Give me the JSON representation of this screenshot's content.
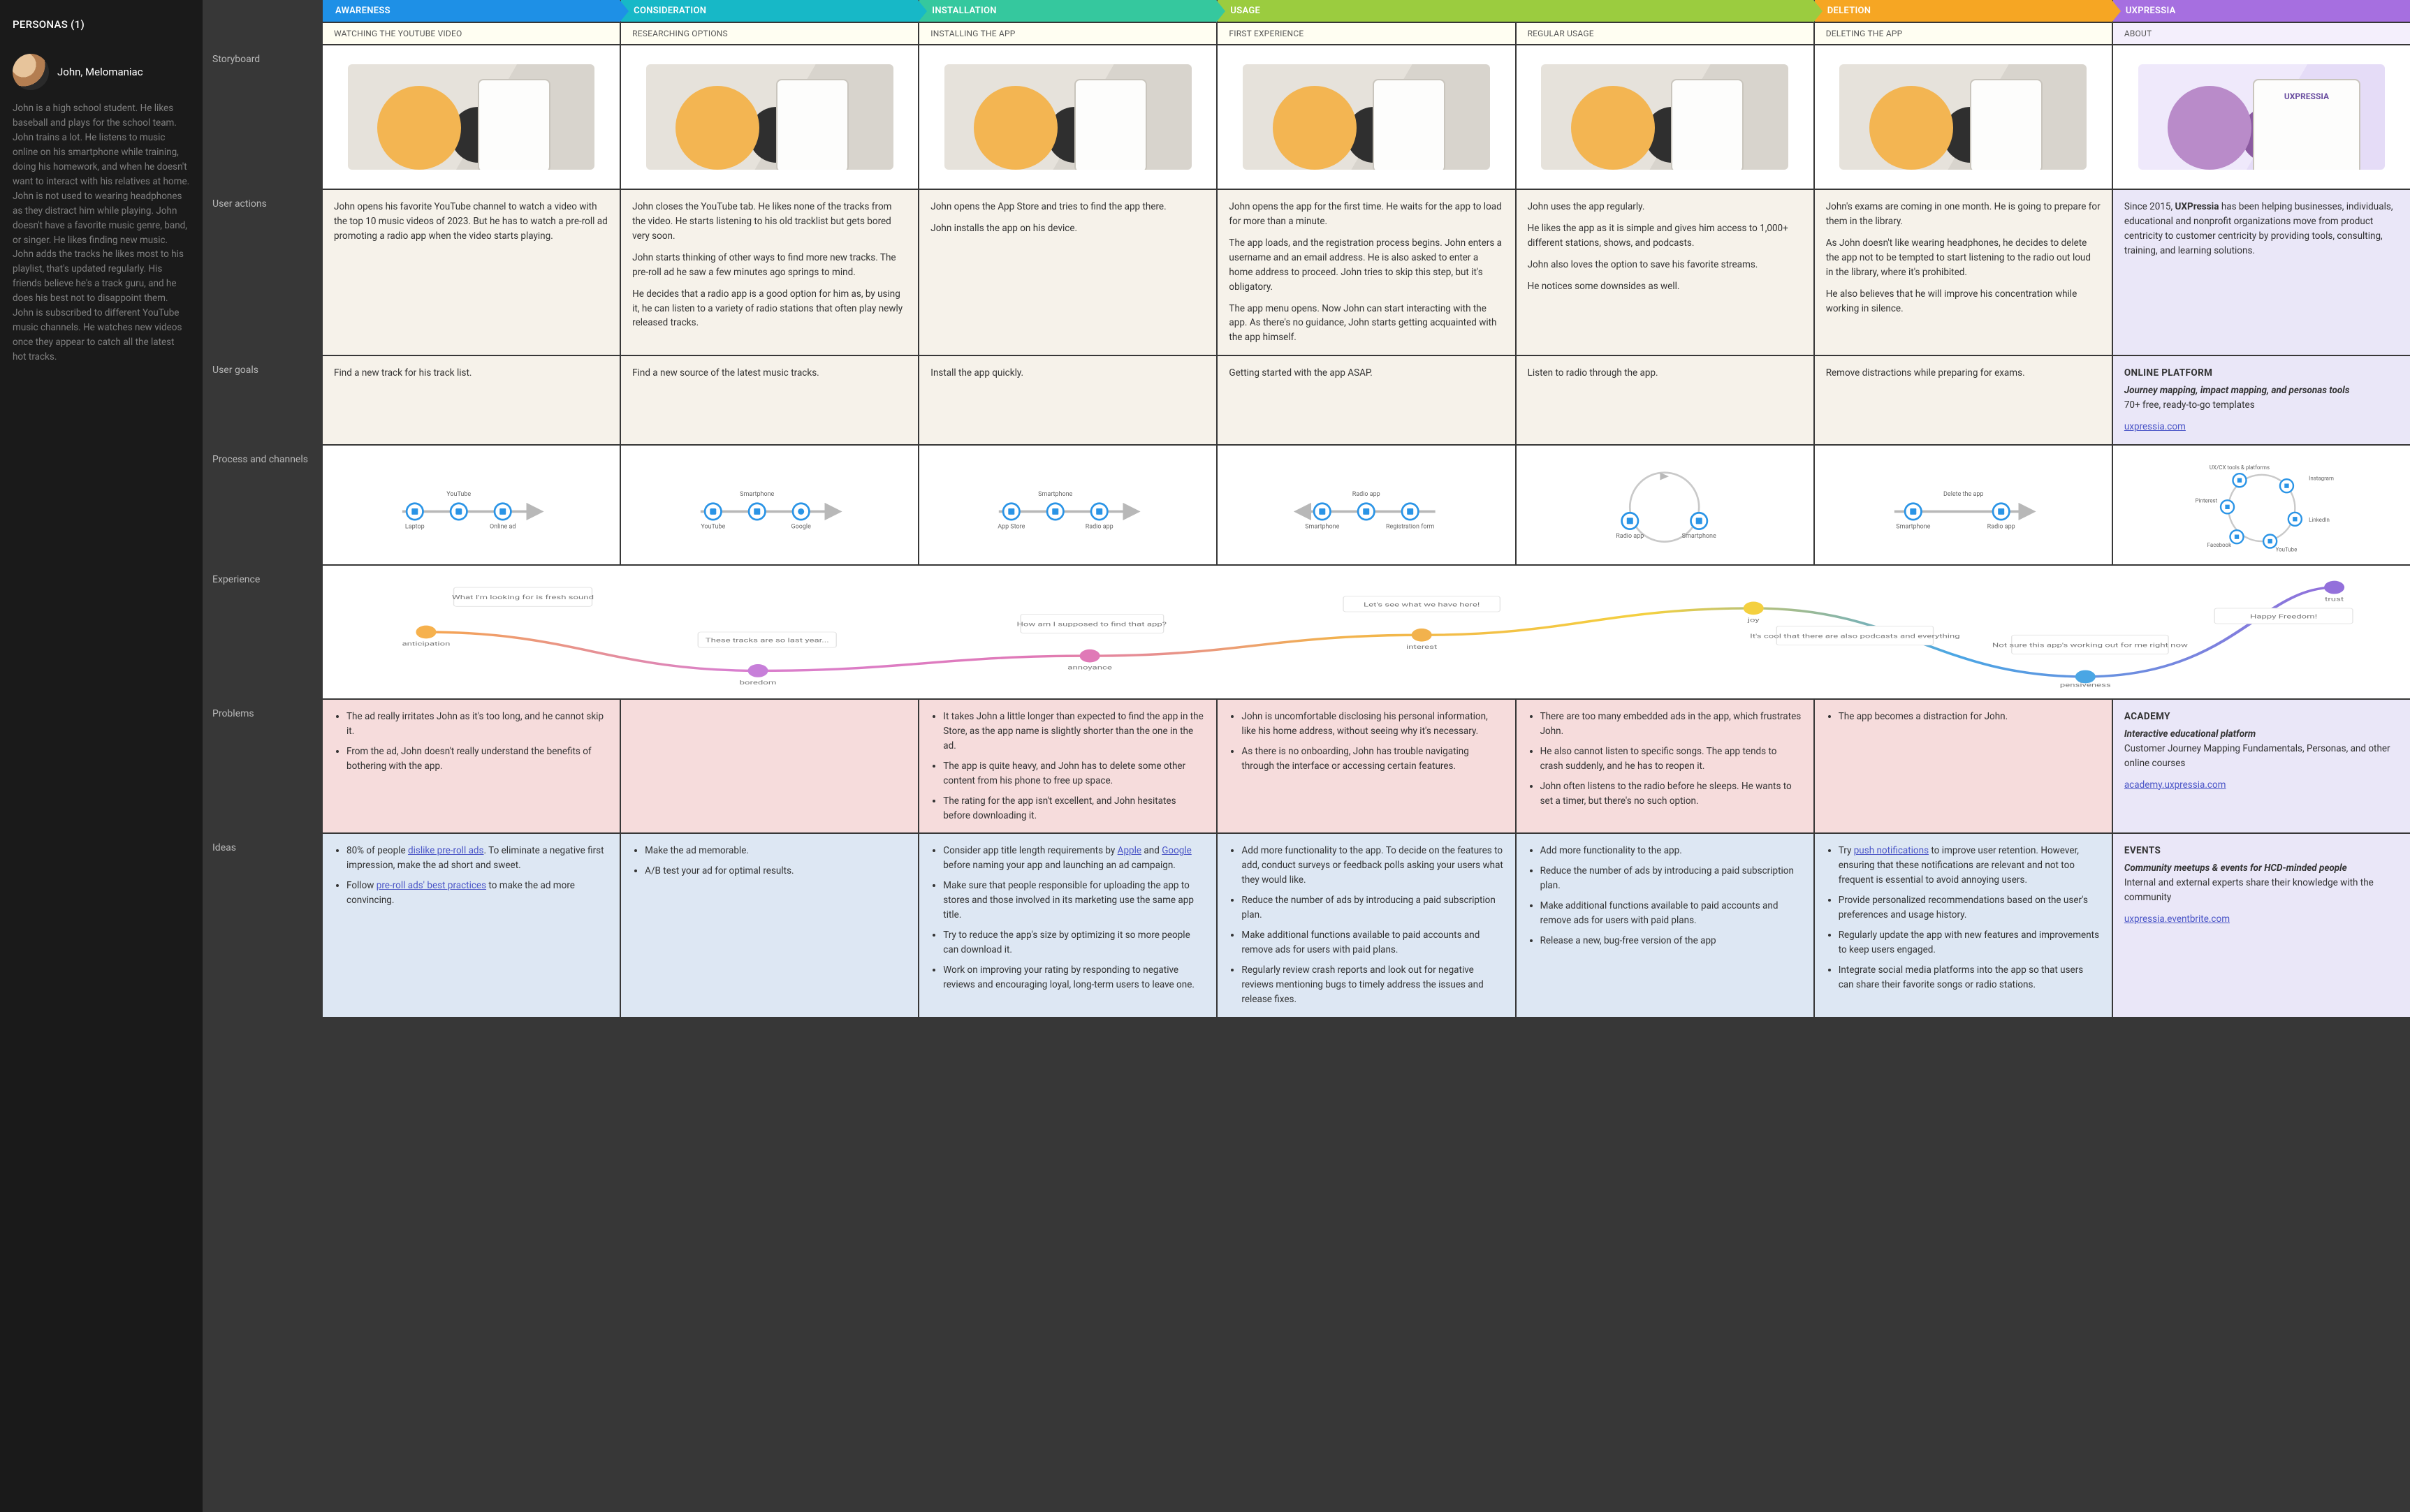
{
  "sidebar": {
    "title": "PERSONAS (1)",
    "persona": {
      "name": "John, Melomaniac",
      "bio": "John is a high school student. He likes baseball and plays for the school team. John trains a lot. He listens to music online on his smartphone while training, doing his homework, and when he doesn't want to interact with his relatives at home. John is not used to wearing headphones as they distract him while playing. John doesn't have a favorite music genre, band, or singer. He likes finding new music. John adds the tracks he likes most to his playlist, that's updated regularly. His friends believe he's a track guru, and he does his best not to disappoint them. John is subscribed to different YouTube music channels. He watches new videos once they appear to catch all the latest hot tracks."
    }
  },
  "phases": {
    "awareness": "AWARENESS",
    "consideration": "CONSIDERATION",
    "installation": "INSTALLATION",
    "usage": "USAGE",
    "deletion": "DELETION",
    "uxpressia": "UXPRESSIA"
  },
  "stages": {
    "s1": "WATCHING THE YOUTUBE VIDEO",
    "s2": "RESEARCHING OPTIONS",
    "s3": "INSTALLING THE APP",
    "s4": "FIRST EXPERIENCE",
    "s5": "REGULAR USAGE",
    "s6": "DELETING THE APP",
    "s7": "ABOUT"
  },
  "rowLabels": {
    "storyboard": "Storyboard",
    "userActions": "User actions",
    "userGoals": "User goals",
    "processChannels": "Process and channels",
    "experience": "Experience",
    "problems": "Problems",
    "ideas": "Ideas"
  },
  "userActions": {
    "c1": "John opens his favorite YouTube channel to watch a video with the top 10 music videos of 2023. But he has to watch a pre-roll ad promoting a radio app when the video starts playing.",
    "c2_p1": "John closes the YouTube tab. He likes none of the tracks from the video. He starts listening to his old tracklist but gets bored very soon.",
    "c2_p2": "John starts thinking of other ways to find more new tracks. The pre-roll ad he saw a few minutes ago springs to mind.",
    "c2_p3": "He decides that a radio app is a good option for him as, by using it, he can listen to a variety of radio stations that often play newly released tracks.",
    "c3_p1": "John opens the App Store and tries to find the app there.",
    "c3_p2": "John installs the app on his device.",
    "c4_p1": "John opens the app for the first time. He waits for the app to load for more than a minute.",
    "c4_p2": "The app loads, and the registration process begins. John enters a username and an email address. He is also asked to enter a home address to proceed. John tries to skip this step, but it's obligatory.",
    "c4_p3": "The app menu opens. Now John can start interacting with the app. As there's no guidance, John starts getting acquainted with the app himself.",
    "c5_p1": "John uses the app regularly.",
    "c5_p2": "He likes the app as it is simple and gives him access to 1,000+ different stations, shows, and podcasts.",
    "c5_p3": "John also loves the option to save his favorite streams.",
    "c5_p4": "He notices some downsides as well.",
    "c6_p1": "John's exams are coming in one month. He is going to prepare for them in the library.",
    "c6_p2": "As John doesn't like wearing headphones, he decides to delete the app not to be tempted to start listening to the radio out loud in the library, where it's prohibited.",
    "c6_p3": "He also believes that he will improve his concentration while working in silence.",
    "c7": "Since 2015, UXPressia has been helping businesses, individuals, educational and nonprofit organizations move from product centricity to customer centricity by providing tools, consulting, training, and learning solutions.",
    "c7_bold": "UXPressia"
  },
  "userGoals": {
    "c1": "Find a new track for his track list.",
    "c2": "Find a new source of the latest music tracks.",
    "c3": "Install the app quickly.",
    "c4": "Getting started with the app ASAP.",
    "c5": "Listen to radio through the app.",
    "c6": "Remove distractions while preparing for exams.",
    "c7_title": "ONLINE PLATFORM",
    "c7_sub": "Journey mapping, impact mapping, and personas tools",
    "c7_body": "70+ free, ready-to-go templates",
    "c7_link": "uxpressia.com"
  },
  "channels": {
    "c1": {
      "top": "YouTube",
      "left": "Laptop",
      "right": "Online ad"
    },
    "c2": {
      "top": "Smartphone",
      "left": "YouTube",
      "right": "Google"
    },
    "c3": {
      "top": "Smartphone",
      "left": "App Store",
      "right": "Radio app"
    },
    "c4": {
      "top": "Radio app",
      "left": "Smartphone",
      "right": "Registration form"
    },
    "c5": {
      "left": "Radio app",
      "right": "Smartphone"
    },
    "c6": {
      "top": "Delete the app",
      "left": "Smartphone",
      "right": "Radio app"
    },
    "c7": {
      "title": "UX/CX tools & platforms",
      "n1": "Instagram",
      "n2": "LinkedIn",
      "n3": "YouTube",
      "n4": "Facebook",
      "n5": "Pinterest"
    }
  },
  "experience": {
    "moods": {
      "m1": "anticipation",
      "m2": "boredom",
      "m3": "annoyance",
      "m4": "interest",
      "m5": "joy",
      "m6": "pensiveness",
      "m7": "trust"
    },
    "quotes": {
      "q1": "What I'm looking for is fresh sound",
      "q2": "These tracks are so last year...",
      "q3": "How am I supposed to find that app?",
      "q4": "Let's see what we have here!",
      "q5": "It's cool that there are also podcasts and everything",
      "q6": "Not sure this app's working out for me right now",
      "q7": "Happy Freedom!"
    }
  },
  "problems": {
    "c1_li1": "The ad really irritates John as it's too long, and he cannot skip it.",
    "c1_li2": "From the ad, John doesn't really understand the benefits of bothering with the app.",
    "c3_li1": "It takes John a little longer than expected to find the app in the Store, as the app name is slightly shorter than the one in the ad.",
    "c3_li2": "The app is quite heavy, and John has to delete some other content from his phone to free up space.",
    "c3_li3": "The rating for the app isn't excellent, and John hesitates before downloading it.",
    "c4_li1": "John is uncomfortable disclosing his personal information, like his home address, without seeing why it's necessary.",
    "c4_li2": "As there is no onboarding, John has trouble navigating through the interface or accessing certain features.",
    "c5_li1": "There are too many embedded ads in the app, which frustrates John.",
    "c5_li2": "He also cannot listen to specific songs. The app tends to crash suddenly, and he has to reopen it.",
    "c5_li3": "John often listens to the radio before he sleeps. He wants to set a timer, but there's no such option.",
    "c6_li1": "The app becomes a distraction for John.",
    "c7_title": "ACADEMY",
    "c7_sub": "Interactive educational platform",
    "c7_body": "Customer Journey Mapping Fundamentals, Personas, and other online courses",
    "c7_link": "academy.uxpressia.com"
  },
  "ideas": {
    "c1_li1_pre": "80% of people ",
    "c1_li1_link": "dislike pre-roll ads",
    "c1_li1_post": ". To eliminate a negative first impression, make the ad short and sweet.",
    "c1_li2_pre": "Follow ",
    "c1_li2_link": "pre-roll ads' best practices",
    "c1_li2_post": " to make the ad more convincing.",
    "c2_li1": "Make the ad memorable.",
    "c2_li2": "A/B test your ad for optimal results.",
    "c3_li1_pre": "Consider app title length requirements by ",
    "c3_li1_link1": "Apple",
    "c3_li1_mid": " and ",
    "c3_li1_link2": "Google",
    "c3_li1_post": " before naming your app and launching an ad campaign.",
    "c3_li2": "Make sure that people responsible for uploading the app to stores and those involved in its marketing use the same app title.",
    "c3_li3": "Try to reduce the app's size by optimizing it so more people can download it.",
    "c3_li4": "Work on improving your rating by responding to negative reviews and encouraging loyal, long-term users to leave one.",
    "c4_li1": "Add more functionality to the app. To decide on the features to add, conduct surveys or feedback polls asking your users what they would like.",
    "c4_li2": "Reduce the number of ads by introducing a paid subscription plan.",
    "c4_li3": "Make additional functions available to paid accounts and remove ads for users with paid plans.",
    "c4_li4": "Regularly review crash reports and look out for negative reviews mentioning bugs to timely address the issues and release fixes.",
    "c5_li1": "Add more functionality to the app.",
    "c5_li2": "Reduce the number of ads by introducing a paid subscription plan.",
    "c5_li3": "Make additional functions available to paid accounts and remove ads for users with paid plans.",
    "c5_li4": "Release a new, bug-free version of the app",
    "c6_li1_pre": "Try ",
    "c6_li1_link": "push notifications",
    "c6_li1_post": " to improve user retention. However, ensuring that these notifications are relevant and not too frequent is essential to avoid annoying users.",
    "c6_li2": "Provide personalized recommendations based on the user's preferences and usage history.",
    "c6_li3": "Regularly update the app with new features and improvements to keep users engaged.",
    "c6_li4": "Integrate social media platforms into the app so that users can share their favorite songs or radio stations.",
    "c7_title": "EVENTS",
    "c7_sub": "Community meetups & events for HCD-minded people",
    "c7_body": "Internal and external experts share their knowledge with the community",
    "c7_link": "uxpressia.eventbrite.com"
  }
}
